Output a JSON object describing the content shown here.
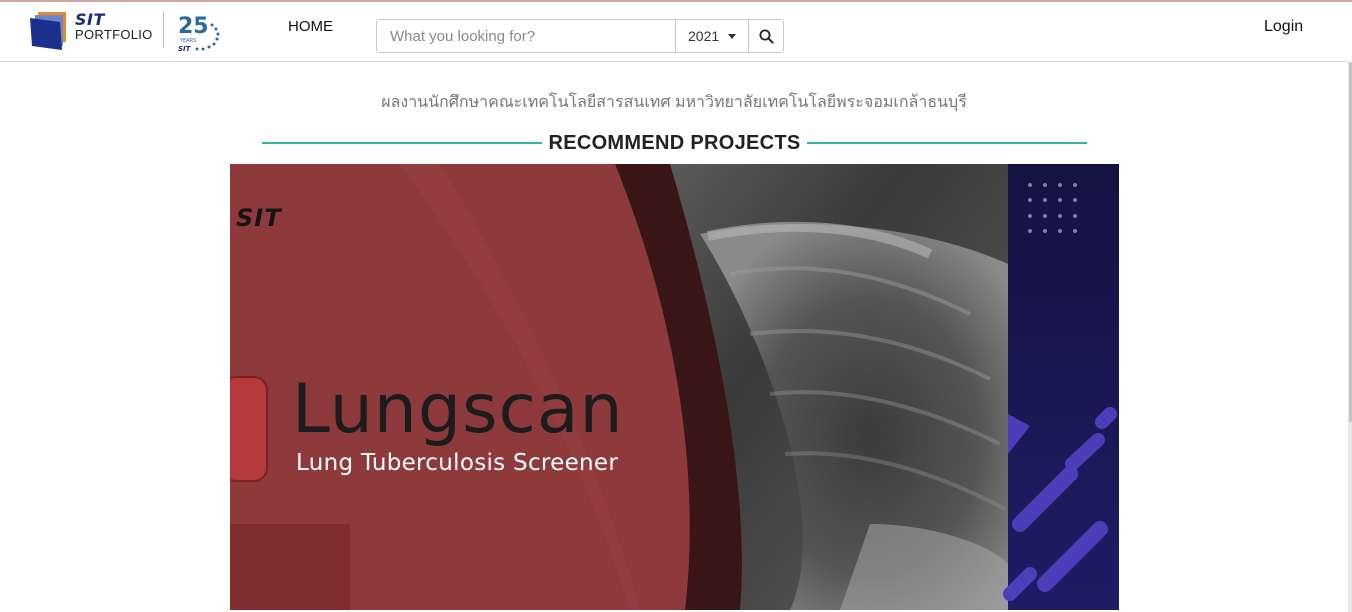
{
  "brand": {
    "name_top": "SIT",
    "name_bottom": "PORTFOLIO",
    "anniversary_number": "25",
    "anniversary_word": "YEARS",
    "anniversary_org": "SIT"
  },
  "nav": {
    "home_label": "HOME",
    "login_label": "Login"
  },
  "search": {
    "placeholder": "What you looking for?",
    "value": "",
    "year_selected": "2021",
    "button_icon": "search-icon"
  },
  "page": {
    "subtitle": "ผลงานนักศึกษาคณะเทคโนโลยีสารสนเทศ มหาวิทยาลัยเทคโนโลยีพระจอมเกล้าธนบุรี",
    "section_title": "RECOMMEND PROJECTS"
  },
  "carousel": {
    "slide": {
      "brand_text": "SIT",
      "title_part1": "Lung",
      "title_part2": "scan",
      "subtitle": "Lung Tuberculosis Screener"
    }
  },
  "colors": {
    "accent_rule": "#33b3a6",
    "banner_red": "#8e3a3c",
    "banner_navy": "#16174f"
  }
}
